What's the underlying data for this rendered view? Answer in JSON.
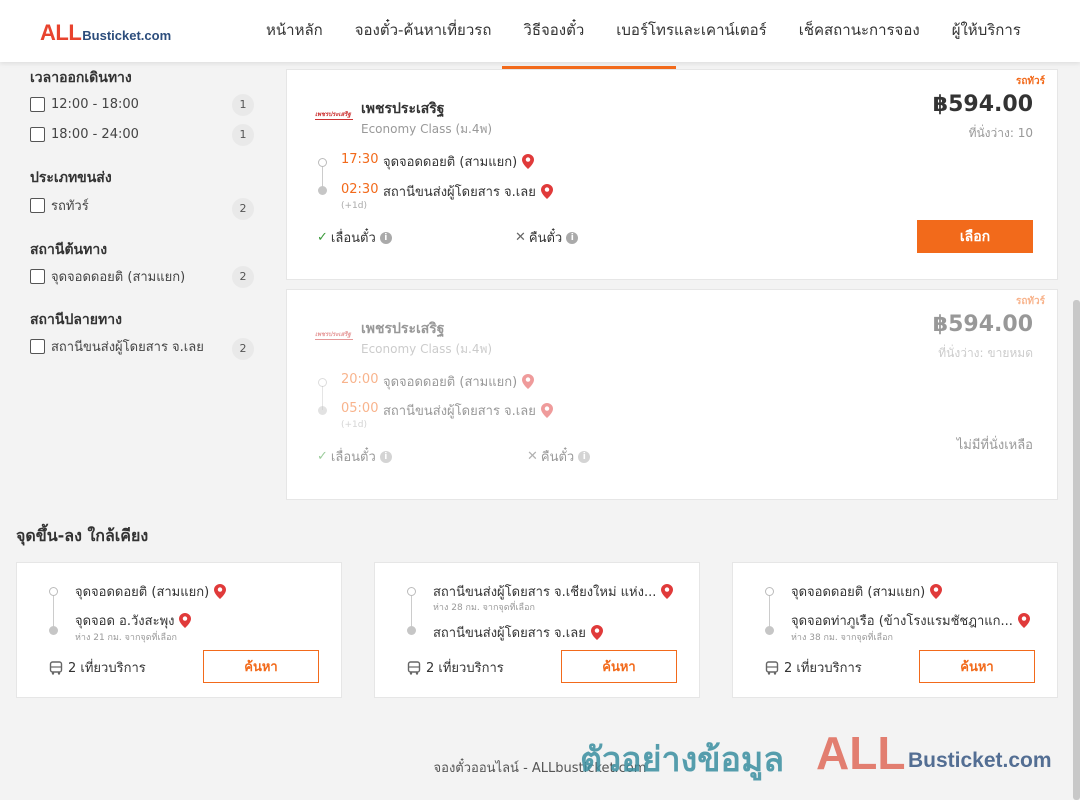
{
  "header": {
    "logo_all": "ALL",
    "logo_busticket": "Busticket.com",
    "nav": [
      "หน้าหลัก",
      "จองตั๋ว-ค้นหาเที่ยวรถ",
      "วิธีจองตั๋ว",
      "เบอร์โทรและเคาน์เตอร์",
      "เช็คสถานะการจอง",
      "ผู้ให้บริการ"
    ]
  },
  "filters": {
    "departure_time": {
      "title": "เวลาออกเดินทาง",
      "options": [
        {
          "label": "12:00 - 18:00",
          "count": "1"
        },
        {
          "label": "18:00 - 24:00",
          "count": "1"
        }
      ]
    },
    "vehicle_type": {
      "title": "ประเภทขนส่ง",
      "options": [
        {
          "label": "รถทัวร์",
          "count": "2"
        }
      ]
    },
    "origin": {
      "title": "สถานีต้นทาง",
      "options": [
        {
          "label": "จุดจอดดอยติ (สามแยก)",
          "count": "2"
        }
      ]
    },
    "destination": {
      "title": "สถานีปลายทาง",
      "options": [
        {
          "label": "สถานีขนส่งผู้โดยสาร จ.เลย",
          "count": "2"
        }
      ]
    }
  },
  "trips": [
    {
      "tag": "รถทัวร์",
      "operator": "เพชรประเสริฐ",
      "class": "Economy Class (ม.4พ)",
      "price": "฿594.00",
      "seats": "ที่นั่งว่าง: 10",
      "depart_time": "17:30",
      "depart_stop": "จุดจอดดอยติ (สามแยก)",
      "arrive_time": "02:30",
      "arrive_stop": "สถานีขนส่งผู้โดยสาร จ.เลย",
      "plus_day": "(+1d)",
      "reschedule": "เลื่อนตั๋ว",
      "refund": "คืนตั๋ว",
      "select_label": "เลือก"
    },
    {
      "tag": "รถทัวร์",
      "operator": "เพชรประเสริฐ",
      "class": "Economy Class (ม.4พ)",
      "price": "฿594.00",
      "seats": "ที่นั่งว่าง: ขายหมด",
      "depart_time": "20:00",
      "depart_stop": "จุดจอดดอยติ (สามแยก)",
      "arrive_time": "05:00",
      "arrive_stop": "สถานีขนส่งผู้โดยสาร จ.เลย",
      "plus_day": "(+1d)",
      "reschedule": "เลื่อนตั๋ว",
      "refund": "คืนตั๋ว",
      "soldout_label": "ไม่มีที่นั่งเหลือ"
    }
  ],
  "nearby": {
    "title": "จุดขึ้น-ลง ใกล้เคียง",
    "cards": [
      {
        "from": "จุดจอดดอยติ (สามแยก)",
        "from_sub": "",
        "to": "จุดจอด อ.วังสะพุง",
        "to_sub": "ห่าง 21 กม. จากจุดที่เลือก",
        "trips": "2 เที่ยวบริการ",
        "button": "ค้นหา"
      },
      {
        "from": "สถานีขนส่งผู้โดยสาร จ.เชียงใหม่ แห่ง...",
        "from_sub": "ห่าง 28 กม. จากจุดที่เลือก",
        "to": "สถานีขนส่งผู้โดยสาร จ.เลย",
        "to_sub": "",
        "trips": "2 เที่ยวบริการ",
        "button": "ค้นหา"
      },
      {
        "from": "จุดจอดดอยติ (สามแยก)",
        "from_sub": "",
        "to": "จุดจอดท่าภูเรือ (ข้างโรงแรมชัชฎาแก...",
        "to_sub": "ห่าง 38 กม. จากจุดที่เลือก",
        "trips": "2 เที่ยวบริการ",
        "button": "ค้นหา"
      }
    ]
  },
  "footer": "จองตั๋วออนไลน์ - ALLbusticket.com",
  "watermark": {
    "thai": "ตัวอย่างข้อมูล",
    "all": "ALL",
    "busticket": "Busticket.com"
  },
  "colors": {
    "accent": "#f26a1b",
    "brand_red": "#e8432e",
    "brand_blue": "#2c4d7c",
    "pin": "#e03a3a"
  }
}
